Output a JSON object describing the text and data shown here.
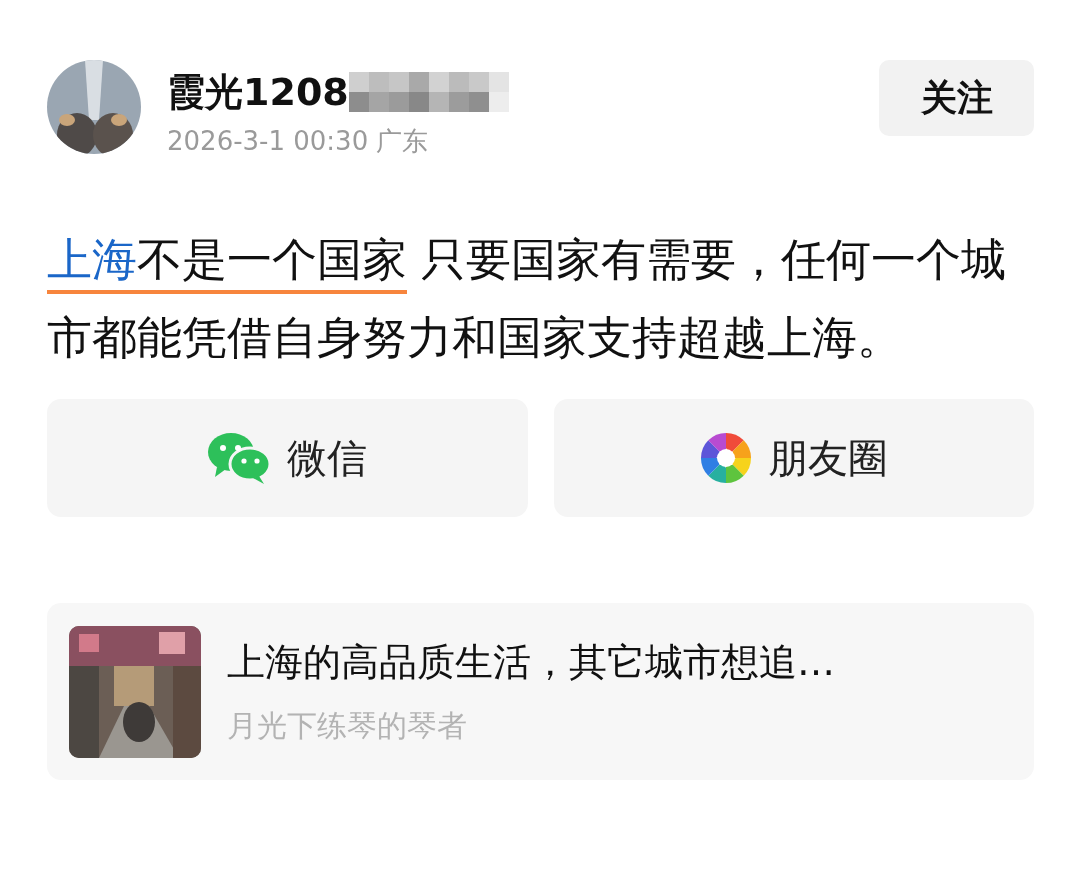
{
  "post": {
    "author": {
      "name": "霞光1208",
      "redacted": true,
      "time": "2026-3-1 00:30",
      "location": "广东"
    },
    "follow_button": "关注",
    "text": [
      {
        "kind": "link",
        "text": "上海",
        "marked": true
      },
      {
        "kind": "plain",
        "text": "不是一个国家",
        "marked": true
      },
      {
        "kind": "plain",
        "text": " 只要国家有需要，任何一个城市都能凭借自身努力和国家支持超越上海。",
        "marked": false
      }
    ]
  },
  "share": [
    {
      "kind": "wechat",
      "label": "微信"
    },
    {
      "kind": "moments",
      "label": "朋友圈"
    }
  ],
  "related": {
    "title": "上海的高品质生活，其它城市想追…",
    "source": "月光下练琴的琴者"
  }
}
